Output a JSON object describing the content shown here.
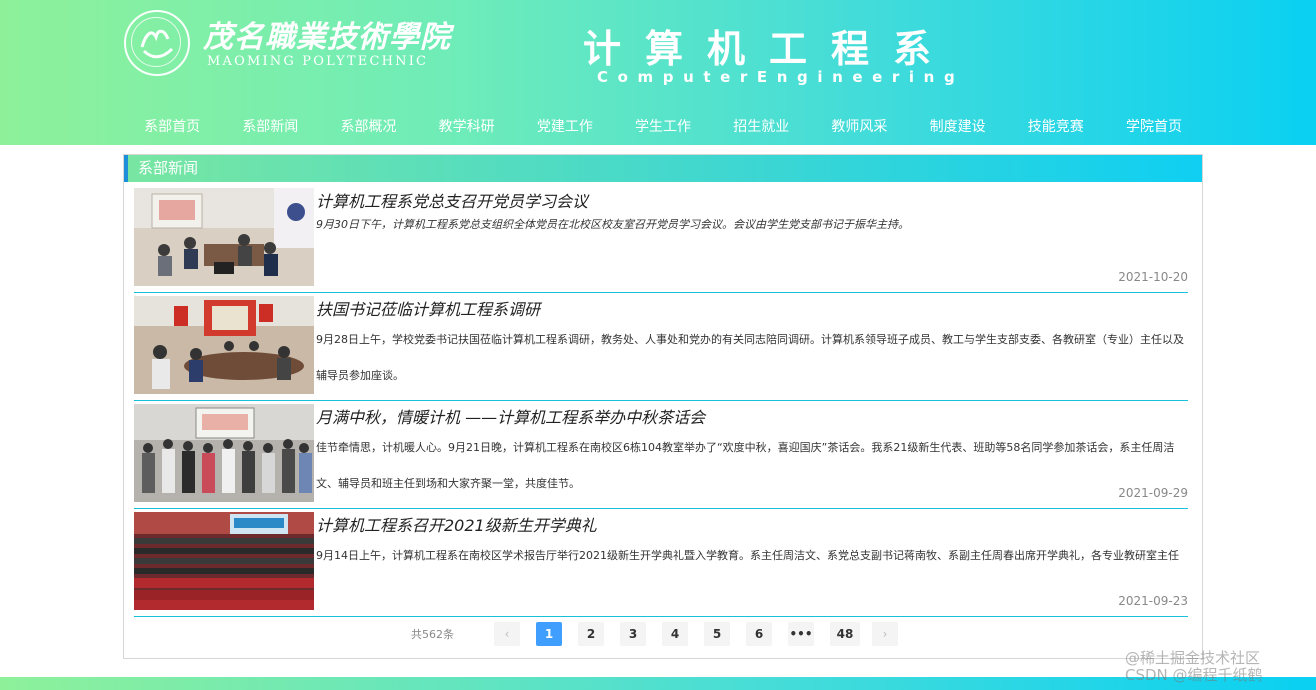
{
  "header": {
    "school_name_cn": "茂名職業技術學院",
    "school_name_en": "MAOMING POLYTECHNIC",
    "dept_name_cn": "计算机工程系",
    "dept_name_en": "ComputerEngineering"
  },
  "nav": {
    "items": [
      {
        "label": "系部首页"
      },
      {
        "label": "系部新闻"
      },
      {
        "label": "系部概况"
      },
      {
        "label": "教学科研"
      },
      {
        "label": "党建工作"
      },
      {
        "label": "学生工作"
      },
      {
        "label": "招生就业"
      },
      {
        "label": "教师风采"
      },
      {
        "label": "制度建设"
      },
      {
        "label": "技能竞赛"
      },
      {
        "label": "学院首页"
      }
    ]
  },
  "panel": {
    "title": "系部新闻",
    "news": [
      {
        "title": "计算机工程系党总支召开党员学习会议",
        "summary": "9月30日下午，计算机工程系党总支组织全体党员在北校区校友室召开党员学习会议。会议由学生党支部书记于振华主持。",
        "date": "2021-10-20"
      },
      {
        "title": "扶国书记莅临计算机工程系调研",
        "summary": "9月28日上午，学校党委书记扶国莅临计算机工程系调研，教务处、人事处和党办的有关同志陪同调研。计算机系领导班子成员、教工与学生支部支委、各教研室（专业）主任以及辅导员参加座谈。",
        "date": ""
      },
      {
        "title": "月满中秋，情暖计机 ——计算机工程系举办中秋茶话会",
        "summary": "佳节牵情思，计机暖人心。9月21日晚，计算机工程系在南校区6栋104教室举办了“欢度中秋，喜迎国庆”茶话会。我系21级新生代表、班助等58名同学参加茶话会，系主任周洁文、辅导员和班主任到场和大家齐聚一堂，共度佳节。",
        "date": "2021-09-29"
      },
      {
        "title": "计算机工程系召开2021级新生开学典礼",
        "summary": "9月14日上午，计算机工程系在南校区学术报告厅举行2021级新生开学典礼暨入学教育。系主任周洁文、系党总支副书记蒋南牧、系副主任周春出席开学典礼，各专业教研室主任",
        "date": "2021-09-23"
      }
    ]
  },
  "pagination": {
    "total": "共562条",
    "prev": "‹",
    "next": "›",
    "pages": [
      "1",
      "2",
      "3",
      "4",
      "5",
      "6",
      "•••",
      "48"
    ],
    "current": "1"
  },
  "watermark": {
    "line1": "@稀土掘金技术社区",
    "line2": "CSDN @编程千纸鹤"
  }
}
